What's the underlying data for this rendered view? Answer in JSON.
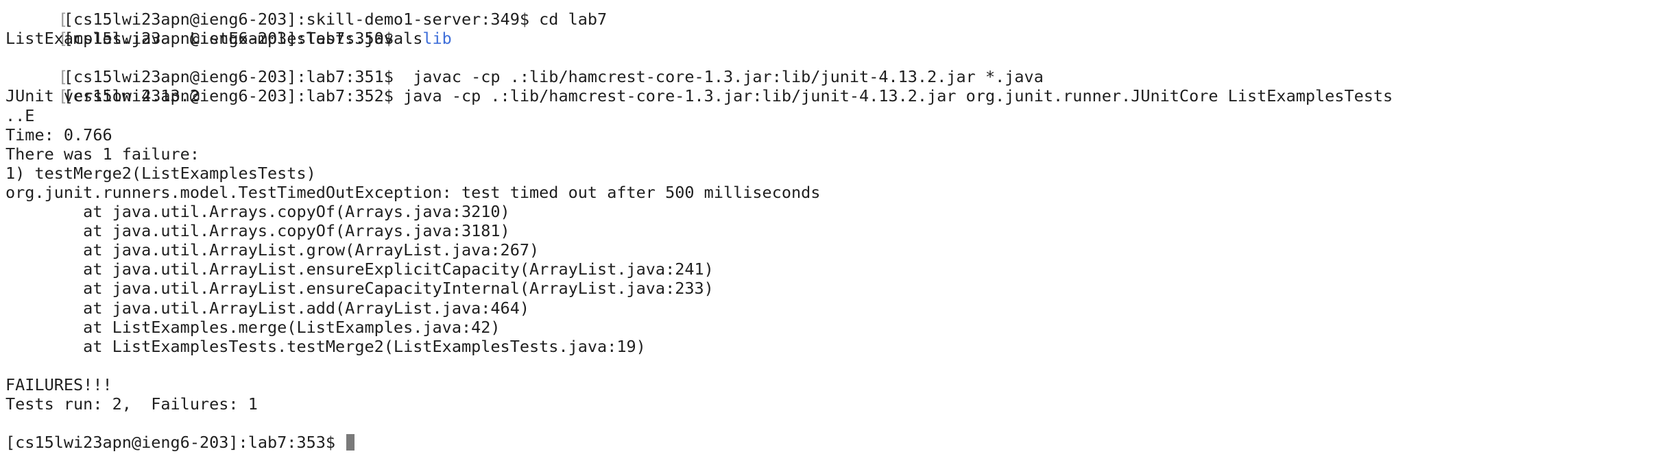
{
  "terminal": {
    "partial_first_line": "[cs15lwi23apn@ieng6-203]:skill-demo1-server:349$ cd lab7",
    "prompt_350": "[cs15lwi23apn@ieng6-203]:lab7:350$ ls",
    "ls_file_1": "ListExamples.java",
    "ls_file_2": "ListExamplesTests.java",
    "ls_dir": "lib",
    "prompt_351": "[cs15lwi23apn@ieng6-203]:lab7:351$  javac -cp .:lib/hamcrest-core-1.3.jar:lib/junit-4.13.2.jar *.java",
    "prompt_352": "[cs15lwi23apn@ieng6-203]:lab7:352$ java -cp .:lib/hamcrest-core-1.3.jar:lib/junit-4.13.2.jar org.junit.runner.JUnitCore ListExamplesTests",
    "junit_version": "JUnit version 4.13.2",
    "progress": "..E",
    "time": "Time: 0.766",
    "failure_summary": "There was 1 failure:",
    "failure_1": "1) testMerge2(ListExamplesTests)",
    "exception": "org.junit.runners.model.TestTimedOutException: test timed out after 500 milliseconds",
    "stack": [
      "        at java.util.Arrays.copyOf(Arrays.java:3210)",
      "        at java.util.Arrays.copyOf(Arrays.java:3181)",
      "        at java.util.ArrayList.grow(ArrayList.java:267)",
      "        at java.util.ArrayList.ensureExplicitCapacity(ArrayList.java:241)",
      "        at java.util.ArrayList.ensureCapacityInternal(ArrayList.java:233)",
      "        at java.util.ArrayList.add(ArrayList.java:464)",
      "        at ListExamples.merge(ListExamples.java:42)",
      "        at ListExamplesTests.testMerge2(ListExamplesTests.java:19)"
    ],
    "failures_banner": "FAILURES!!!",
    "tests_result": "Tests run: 2,  Failures: 1",
    "prompt_353": "[cs15lwi23apn@ieng6-203]:lab7:353$ "
  }
}
